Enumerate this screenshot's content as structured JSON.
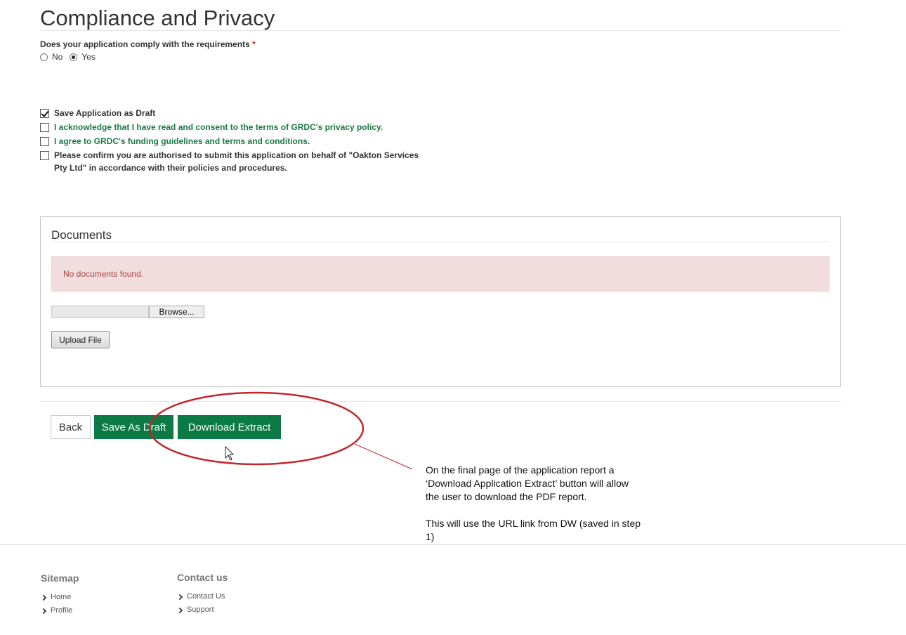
{
  "page": {
    "title": "Compliance and Privacy"
  },
  "compliance": {
    "question": "Does your application comply with the requirements",
    "required_mark": "*",
    "options": [
      {
        "label": "No",
        "selected": false
      },
      {
        "label": "Yes",
        "selected": true
      }
    ]
  },
  "checkboxes": [
    {
      "label": "Save Application as Draft",
      "checked": true,
      "color": "#333333"
    },
    {
      "label": "I acknowledge that I have read and consent to the terms of GRDC's privacy policy.",
      "checked": false,
      "color": "#1b7a47"
    },
    {
      "label": "I agree to GRDC's funding guidelines and terms and conditions.",
      "checked": false,
      "color": "#1b7a47"
    },
    {
      "label": "Please confirm you are authorised to submit this application on behalf of \"Oakton Services Pty Ltd\" in accordance with their policies and procedures.",
      "checked": false,
      "color": "#333333"
    }
  ],
  "documents": {
    "title": "Documents",
    "empty_message": "No documents found.",
    "browse_label": "Browse...",
    "upload_label": "Upload File"
  },
  "actions": {
    "back_label": "Back",
    "save_draft_label": "Save As Draft",
    "download_label": "Download Extract",
    "primary_color": "#0b7a45"
  },
  "annotation": {
    "paragraph1": "On the final page of the application report a ‘Download Application Extract’ button will allow the user to download the PDF report.",
    "paragraph2": "This will use the URL link from DW (saved in step 1)",
    "color": "#c0272d"
  },
  "footer": {
    "sitemap": {
      "title": "Sitemap",
      "links": [
        "Home",
        "Profile"
      ]
    },
    "contact": {
      "title": "Contact us",
      "links": [
        "Contact Us",
        "Support"
      ]
    }
  }
}
